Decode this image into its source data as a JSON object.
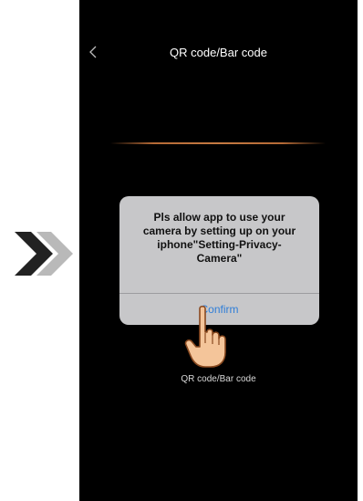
{
  "nav": {
    "title": "QR code/Bar code",
    "back_icon": "chevron-left-icon"
  },
  "dialog": {
    "message": "Pls allow app to use your\ncamera by setting up on your\niphone\"Setting-Privacy-\nCamera\"",
    "confirm_label": "Confirm"
  },
  "scan": {
    "bottom_label": "QR code/Bar code",
    "line_color": "#c57a42"
  },
  "colors": {
    "screen_bg": "#000000",
    "dialog_bg": "#c7c7c9",
    "accent": "#2f7ed8"
  },
  "icons": {
    "indicator": "double-chevron-right-icon",
    "pointer": "pointing-hand-icon"
  }
}
